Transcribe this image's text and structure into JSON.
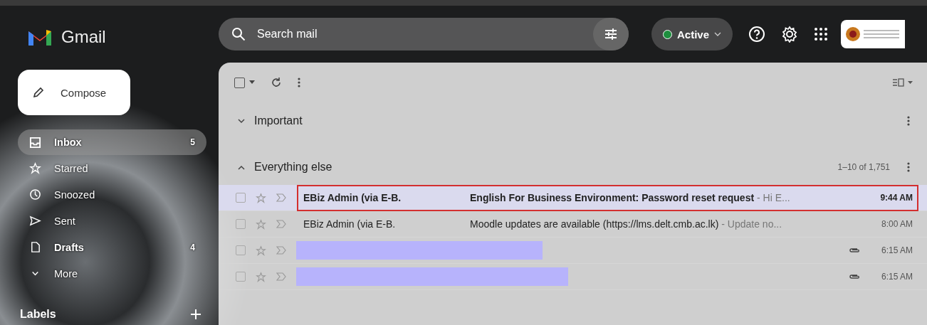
{
  "app": {
    "name": "Gmail"
  },
  "search": {
    "placeholder": "Search mail"
  },
  "select_all": {
    "checked": false
  },
  "status": {
    "label": "Active",
    "color": "#1e8e3e"
  },
  "compose": {
    "label": "Compose"
  },
  "sidebar": {
    "items": [
      {
        "kind": "inbox",
        "label": "Inbox",
        "count": "5",
        "selected": true,
        "unread": true
      },
      {
        "kind": "starred",
        "label": "Starred",
        "selected": false,
        "unread": false
      },
      {
        "kind": "snoozed",
        "label": "Snoozed",
        "selected": false,
        "unread": false
      },
      {
        "kind": "sent",
        "label": "Sent",
        "selected": false,
        "unread": false
      },
      {
        "kind": "drafts",
        "label": "Drafts",
        "count": "4",
        "selected": false,
        "unread": true
      },
      {
        "kind": "more",
        "label": "More",
        "selected": false,
        "unread": false
      }
    ],
    "labels_heading": "Labels"
  },
  "sections": [
    {
      "title": "Important",
      "expanded": false
    },
    {
      "title": "Everything else",
      "expanded": true,
      "pagination": "1–10 of 1,751"
    }
  ],
  "emails": [
    {
      "kind": "message",
      "sender": "EBiz Admin (via E-B.",
      "subject": "English For Business Environment: Password reset request",
      "snippet": " - Hi E...",
      "time": "9:44 AM",
      "unread": true,
      "highlighted": true,
      "attachment": false
    },
    {
      "kind": "message",
      "sender": "EBiz Admin (via E-B.",
      "subject": "Moodle updates are available (https://lms.delt.cmb.ac.lk)",
      "snippet": " - Update no...",
      "time": "8:00 AM",
      "unread": false,
      "highlighted": false,
      "attachment": false
    },
    {
      "kind": "redacted",
      "time": "6:15 AM",
      "unread": false,
      "highlighted": false,
      "attachment": true
    },
    {
      "kind": "redacted",
      "time": "6:15 AM",
      "unread": false,
      "highlighted": false,
      "attachment": true
    }
  ]
}
